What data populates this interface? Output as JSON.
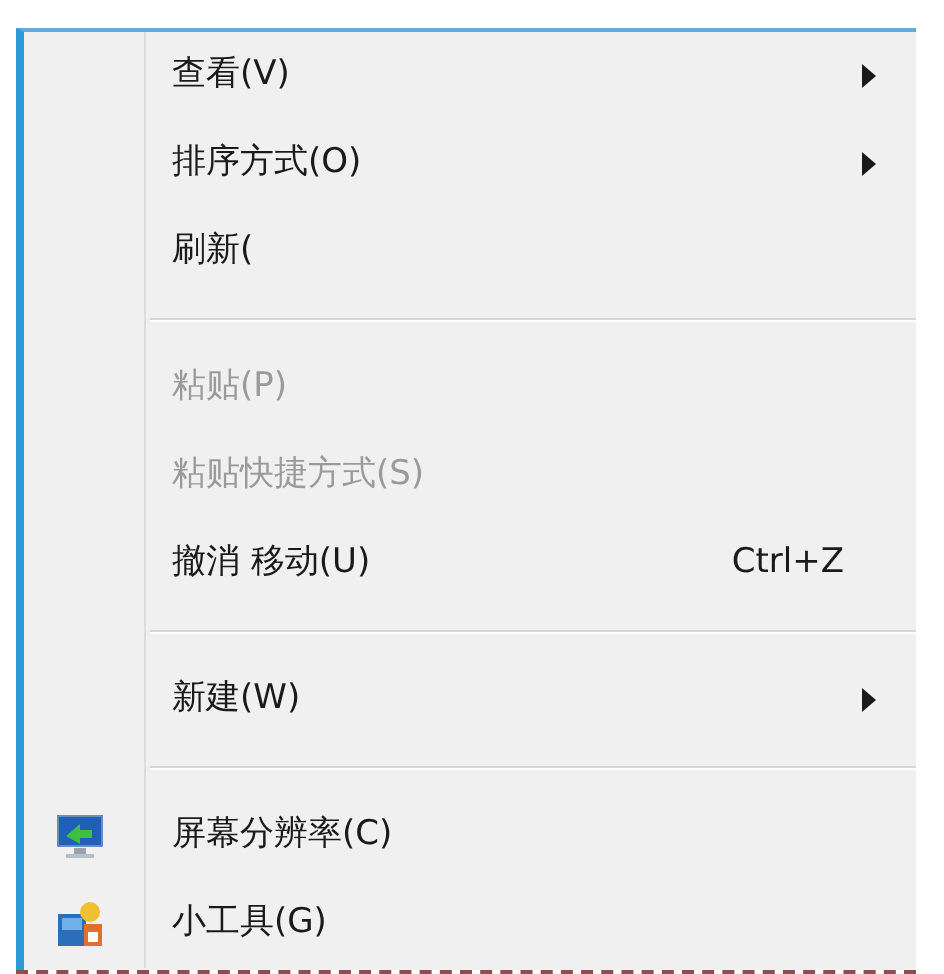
{
  "menu": {
    "items": [
      {
        "kind": "item",
        "label": "查看(V)",
        "disabled": false,
        "submenu": true
      },
      {
        "kind": "item",
        "label": "排序方式(O)",
        "disabled": false,
        "submenu": true
      },
      {
        "kind": "item",
        "label": "刷新(",
        "disabled": false,
        "submenu": false
      },
      {
        "kind": "separator"
      },
      {
        "kind": "item",
        "label": "粘贴(P)",
        "disabled": true,
        "submenu": false
      },
      {
        "kind": "item",
        "label": "粘贴快捷方式(S)",
        "disabled": true,
        "submenu": false
      },
      {
        "kind": "item",
        "label": "撤消 移动(U)",
        "disabled": false,
        "submenu": false,
        "shortcut": "Ctrl+Z"
      },
      {
        "kind": "separator"
      },
      {
        "kind": "item",
        "label": "新建(W)",
        "disabled": false,
        "submenu": true
      },
      {
        "kind": "separator"
      },
      {
        "kind": "display",
        "label": "屏幕分辨率(C)",
        "disabled": false,
        "submenu": false
      },
      {
        "kind": "gadgets",
        "label": "小工具(G)",
        "disabled": false,
        "submenu": false
      }
    ]
  }
}
